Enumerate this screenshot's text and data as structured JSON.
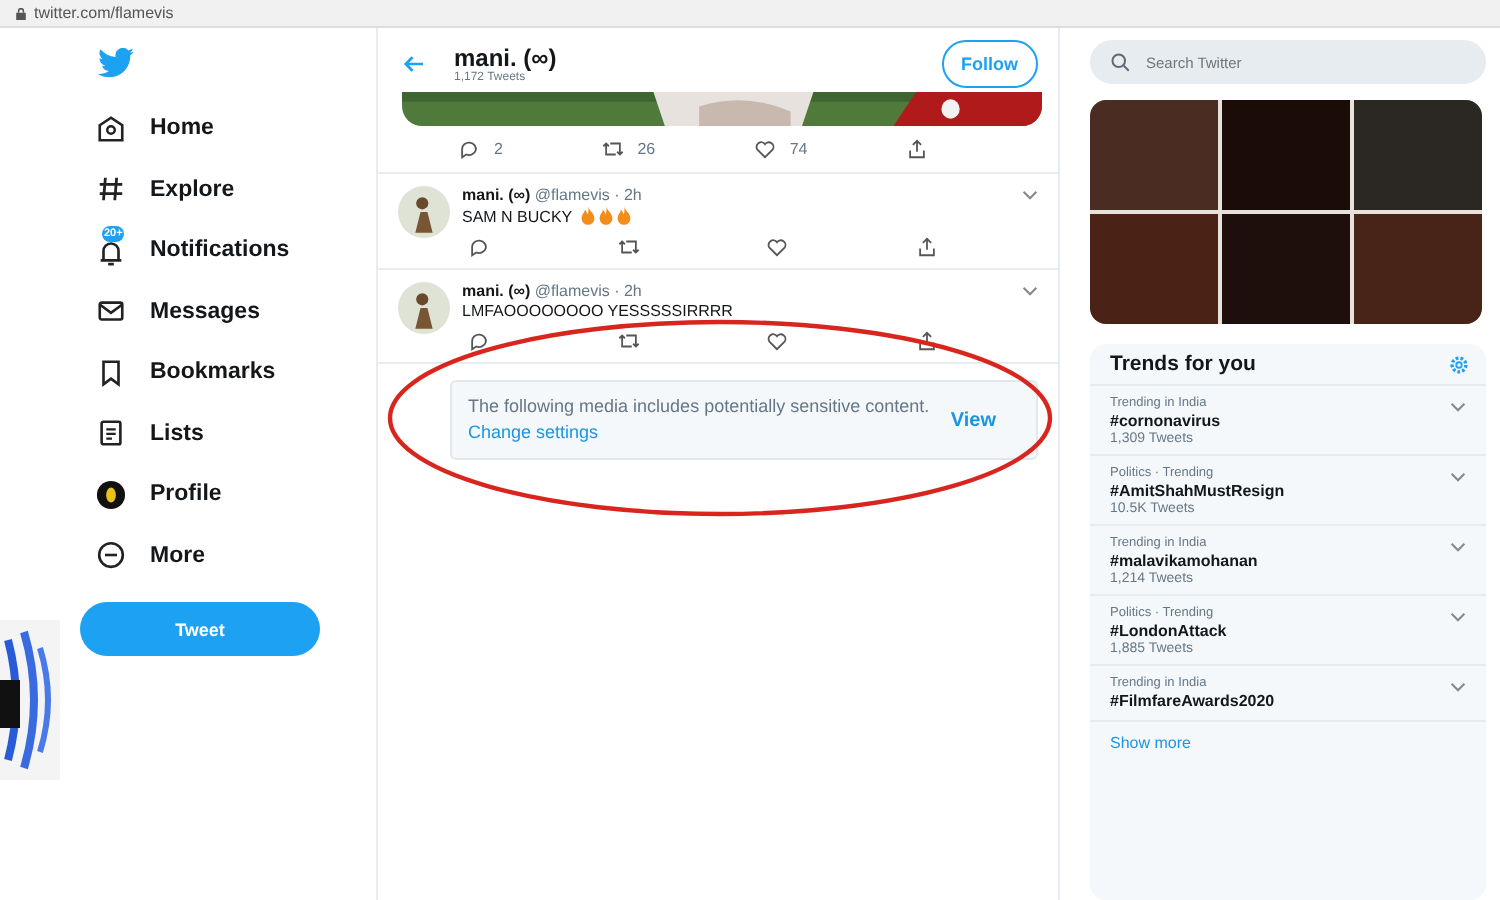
{
  "address_bar": {
    "url": "twitter.com/flamevis"
  },
  "sidebar": {
    "items": [
      {
        "label": "Home"
      },
      {
        "label": "Explore"
      },
      {
        "label": "Notifications",
        "badge": "20+"
      },
      {
        "label": "Messages"
      },
      {
        "label": "Bookmarks"
      },
      {
        "label": "Lists"
      },
      {
        "label": "Profile"
      },
      {
        "label": "More"
      }
    ],
    "tweet_button": "Tweet"
  },
  "header": {
    "name": "mani. (∞)",
    "tweet_count": "1,172 Tweets",
    "follow_button": "Follow"
  },
  "tweets": [
    {
      "kind": "media",
      "replies": "2",
      "retweets": "26",
      "likes": "74"
    },
    {
      "kind": "text",
      "name": "mani. (∞)",
      "handle": "@flamevis · 2h",
      "text": "SAM N BUCKY"
    },
    {
      "kind": "text",
      "name": "mani. (∞)",
      "handle": "@flamevis · 2h",
      "text": "LMFAOOOOOOOO YESSSSSIRRRR"
    }
  ],
  "sensitive_notice": {
    "text": "The following media includes potentially sensitive content.",
    "link": "Change settings",
    "button": "View"
  },
  "search": {
    "placeholder": "Search Twitter"
  },
  "trends": {
    "title": "Trends for you",
    "items": [
      {
        "category": "Trending in India",
        "tag": "#cornonavirus",
        "count": "1,309 Tweets"
      },
      {
        "category": "Politics · Trending",
        "tag": "#AmitShahMustResign",
        "count": "10.5K Tweets"
      },
      {
        "category": "Trending in India",
        "tag": "#malavikamohanan",
        "count": "1,214 Tweets"
      },
      {
        "category": "Politics · Trending",
        "tag": "#LondonAttack",
        "count": "1,885 Tweets"
      },
      {
        "category": "Trending in India",
        "tag": "#FilmfareAwards2020"
      }
    ],
    "show_more": "Show more"
  }
}
